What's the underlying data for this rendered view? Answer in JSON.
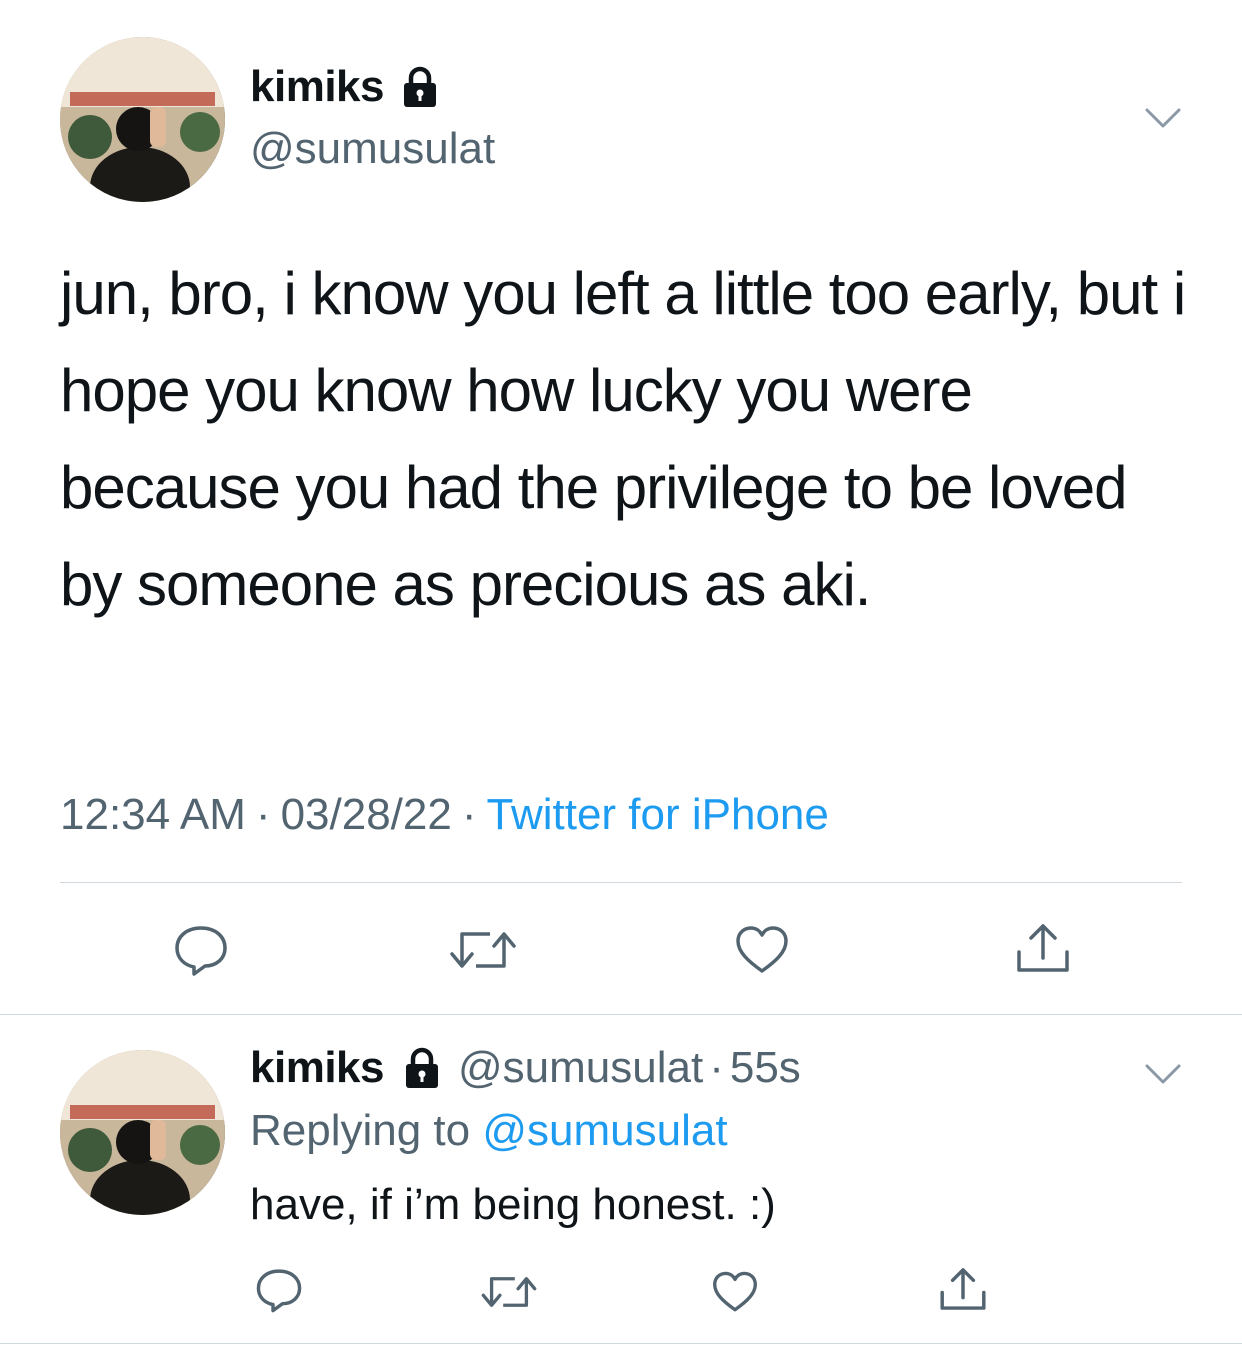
{
  "tweet": {
    "display_name": "kimiks",
    "handle": "@sumusulat",
    "text": "jun, bro, i know you left a little too early, but i hope you know how lucky you were because you had the privilege to be loved by someone as precious as aki.",
    "time": "12:34 AM",
    "date": "03/28/22",
    "separator": "·",
    "source": "Twitter for iPhone",
    "icons": {
      "lock": "lock-icon",
      "more": "chevron-down-icon",
      "reply": "reply-icon",
      "retweet": "retweet-icon",
      "like": "heart-icon",
      "share": "share-icon"
    }
  },
  "reply": {
    "display_name": "kimiks",
    "handle": "@sumusulat",
    "separator": "·",
    "time_ago": "55s",
    "replying_label": "Replying to",
    "replying_to": "@sumusulat",
    "text": "have, if i’m being honest. :)"
  },
  "colors": {
    "text": "#0f1419",
    "secondary": "#536471",
    "link": "#1d9bf0",
    "divider": "#cfd9de"
  }
}
